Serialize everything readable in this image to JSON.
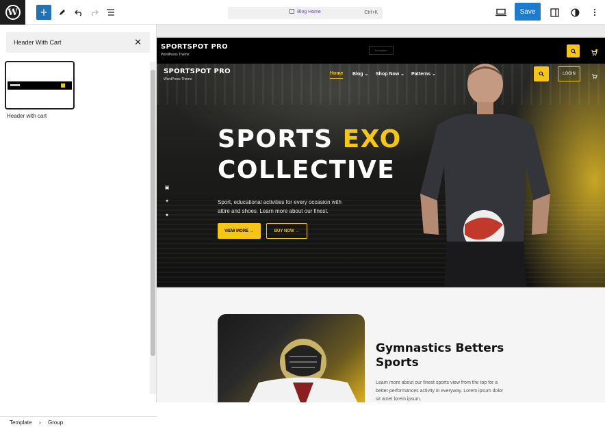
{
  "topbar": {
    "add_label": "+",
    "command": {
      "title": "Blog Home",
      "shortcut": "Ctrl+K"
    },
    "save_label": "Save"
  },
  "sidebar": {
    "search_value": "Header With Cart",
    "pattern_label": "Header with cart",
    "breadcrumb": [
      "Template",
      "Group"
    ]
  },
  "site": {
    "brand": "SPORTSPOT PRO",
    "brand_sub": "WordPress Theme",
    "nav_placeholder": "Navigation",
    "nav": [
      "Home",
      "Blog",
      "Shop Now",
      "Patterns"
    ],
    "login_label": "LOGIN",
    "hero": {
      "line1_a": "SPORTS",
      "line1_b": "EXO",
      "line2": "COLLECTIVE",
      "description": "Sport, educational activities for every occasion with attire and shoes. Learn more about our finest.",
      "btn_primary": "VIEW MORE",
      "btn_secondary": "BUY NOW"
    },
    "section": {
      "heading_1": "Gymnastics Betters",
      "heading_2": "Sports",
      "text": "Learn more about our finest sports view from the top for a better performances activity in everyway. Lorem ipsum dolor sit amet lorem ipsum."
    }
  },
  "colors": {
    "accent": "#f5c518",
    "wp_blue": "#1e7cd0",
    "dark": "#000000"
  }
}
